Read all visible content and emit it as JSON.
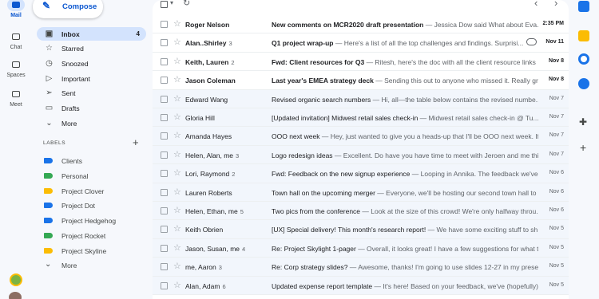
{
  "rail": {
    "items": [
      {
        "label": "Mail",
        "icon": "mail-icon"
      },
      {
        "label": "Chat",
        "icon": "chat-icon"
      },
      {
        "label": "Spaces",
        "icon": "spaces-icon"
      },
      {
        "label": "Meet",
        "icon": "meet-icon"
      }
    ]
  },
  "compose": {
    "label": "Compose"
  },
  "nav": {
    "items": [
      {
        "label": "Inbox",
        "count": "4",
        "icon": "inbox-icon"
      },
      {
        "label": "Starred",
        "count": "",
        "icon": "star-icon"
      },
      {
        "label": "Snoozed",
        "count": "",
        "icon": "clock-icon"
      },
      {
        "label": "Important",
        "count": "",
        "icon": "important-icon"
      },
      {
        "label": "Sent",
        "count": "",
        "icon": "send-icon"
      },
      {
        "label": "Drafts",
        "count": "",
        "icon": "draft-icon"
      },
      {
        "label": "More",
        "count": "",
        "icon": "chevron-down-icon"
      }
    ]
  },
  "labels": {
    "heading": "LABELS",
    "items": [
      {
        "label": "Clients",
        "color": "#1a73e8"
      },
      {
        "label": "Personal",
        "color": "#34a853"
      },
      {
        "label": "Project Clover",
        "color": "#fbbc04"
      },
      {
        "label": "Project Dot",
        "color": "#1a73e8"
      },
      {
        "label": "Project Hedgehog",
        "color": "#1a73e8"
      },
      {
        "label": "Project Rocket",
        "color": "#34a853"
      },
      {
        "label": "Project Skyline",
        "color": "#fbbc04"
      },
      {
        "label": "More",
        "color": ""
      }
    ]
  },
  "mails": [
    {
      "sender": "Roger Nelson",
      "count": "",
      "subject": "New comments on MCR2020 draft presentation",
      "snippet": " — Jessica Dow said What about Eva...",
      "date": "2:35 PM",
      "unread": true,
      "attach": false
    },
    {
      "sender": "Alan..Shirley",
      "count": "3",
      "subject": "Q1 project wrap-up",
      "snippet": " — Here's a list of all the top challenges and findings. Surprisi...",
      "date": "Nov 11",
      "unread": true,
      "attach": true
    },
    {
      "sender": "Keith, Lauren",
      "count": "2",
      "subject": "Fwd: Client resources for Q3",
      "snippet": " — Ritesh, here's the doc with all the client resource links ...",
      "date": "Nov 8",
      "unread": true,
      "attach": false
    },
    {
      "sender": "Jason Coleman",
      "count": "",
      "subject": "Last year's EMEA strategy deck",
      "snippet": " — Sending this out to anyone who missed it. Really gr...",
      "date": "Nov 8",
      "unread": true,
      "attach": false
    },
    {
      "sender": "Edward Wang",
      "count": "",
      "subject": "Revised organic search numbers",
      "snippet": " — Hi, all—the table below contains the revised numbe...",
      "date": "Nov 7",
      "unread": false,
      "attach": false
    },
    {
      "sender": "Gloria Hill",
      "count": "",
      "subject": "[Updated invitation] Midwest retail sales check-in",
      "snippet": " — Midwest retail sales check-in @ Tu...",
      "date": "Nov 7",
      "unread": false,
      "attach": false
    },
    {
      "sender": "Amanda Hayes",
      "count": "",
      "subject": "OOO next week",
      "snippet": " — Hey, just wanted to give you a heads-up that I'll be OOO next week. If ...",
      "date": "Nov 7",
      "unread": false,
      "attach": false
    },
    {
      "sender": "Helen, Alan, me",
      "count": "3",
      "subject": "Logo redesign ideas",
      "snippet": " — Excellent. Do have you have time to meet with Jeroen and me thi...",
      "date": "Nov 7",
      "unread": false,
      "attach": false
    },
    {
      "sender": "Lori, Raymond",
      "count": "2",
      "subject": "Fwd: Feedback on the new signup experience",
      "snippet": " — Looping in Annika. The feedback we've...",
      "date": "Nov 6",
      "unread": false,
      "attach": false
    },
    {
      "sender": "Lauren Roberts",
      "count": "",
      "subject": "Town hall on the upcoming merger",
      "snippet": " — Everyone, we'll be hosting our second town hall to ...",
      "date": "Nov 6",
      "unread": false,
      "attach": false
    },
    {
      "sender": "Helen, Ethan, me",
      "count": "5",
      "subject": "Two pics from the conference",
      "snippet": " — Look at the size of this crowd! We're only halfway throu...",
      "date": "Nov 6",
      "unread": false,
      "attach": false
    },
    {
      "sender": "Keith Obrien",
      "count": "",
      "subject": "[UX] Special delivery! This month's research report!",
      "snippet": " — We have some exciting stuff to sh...",
      "date": "Nov 5",
      "unread": false,
      "attach": false
    },
    {
      "sender": "Jason, Susan, me",
      "count": "4",
      "subject": "Re: Project Skylight 1-pager",
      "snippet": " — Overall, it looks great! I have a few suggestions for what t...",
      "date": "Nov 5",
      "unread": false,
      "attach": false
    },
    {
      "sender": "me, Aaron",
      "count": "3",
      "subject": "Re: Corp strategy slides?",
      "snippet": " — Awesome, thanks! I'm going to use slides 12-27 in my presen...",
      "date": "Nov 5",
      "unread": false,
      "attach": false
    },
    {
      "sender": "Alan, Adam",
      "count": "6",
      "subject": "Updated expense report template",
      "snippet": " — It's here! Based on your feedback, we've (hopefully)...",
      "date": "Nov 5",
      "unread": false,
      "attach": false
    }
  ],
  "side_apps": [
    {
      "name": "calendar-icon",
      "color": "#1a73e8"
    },
    {
      "name": "keep-icon",
      "color": "#fbbc04"
    },
    {
      "name": "tasks-icon",
      "color": "#1a73e8"
    },
    {
      "name": "contacts-icon",
      "color": "#1a73e8"
    }
  ]
}
